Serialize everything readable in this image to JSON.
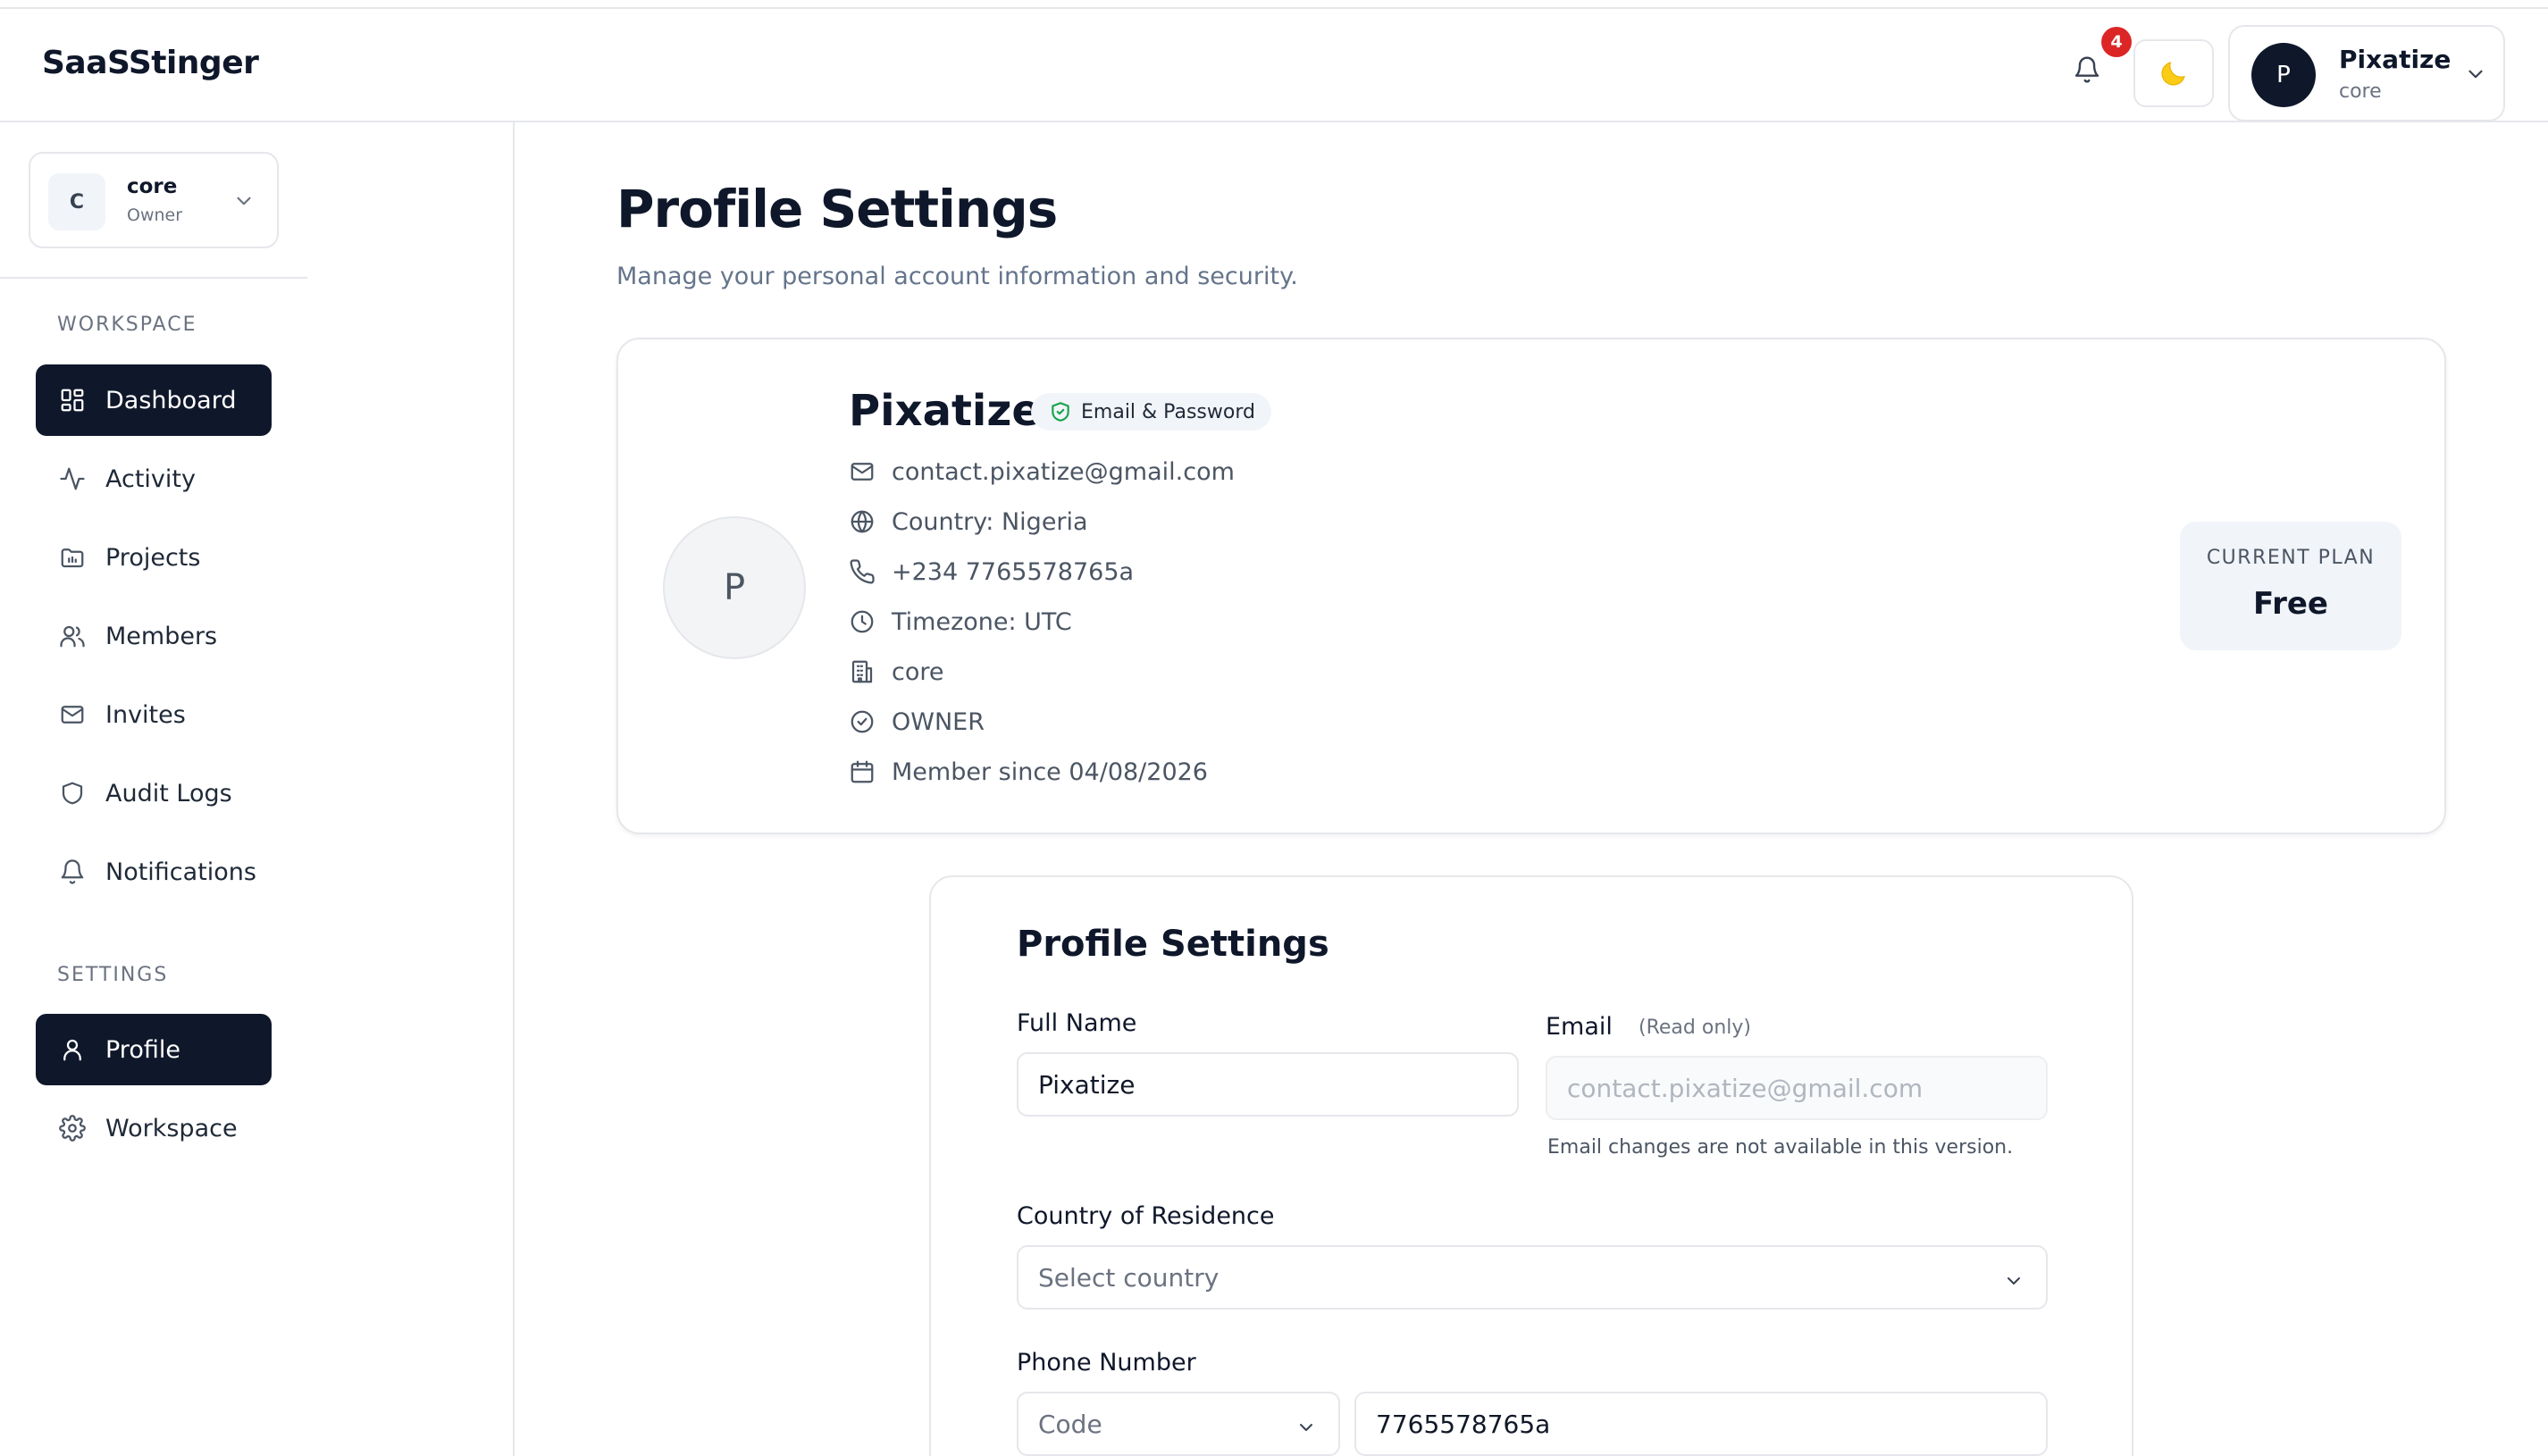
{
  "header": {
    "brand": "SaaSStinger",
    "notification_count": "4",
    "user_name": "Pixatize",
    "user_workspace": "core",
    "user_initial": "P"
  },
  "sidebar": {
    "workspace": {
      "initial": "C",
      "name": "core",
      "role": "Owner"
    },
    "workspace_section": "WORKSPACE",
    "workspace_items": [
      {
        "label": "Dashboard",
        "icon": "dashboard-icon",
        "active": true
      },
      {
        "label": "Activity",
        "icon": "activity-icon"
      },
      {
        "label": "Projects",
        "icon": "folder-icon"
      },
      {
        "label": "Members",
        "icon": "users-icon"
      },
      {
        "label": "Invites",
        "icon": "mail-icon"
      },
      {
        "label": "Audit Logs",
        "icon": "shield-icon"
      },
      {
        "label": "Notifications",
        "icon": "bell-icon"
      }
    ],
    "settings_section": "SETTINGS",
    "settings_items": [
      {
        "label": "Profile",
        "icon": "user-icon",
        "active": true
      },
      {
        "label": "Workspace",
        "icon": "gear-icon"
      }
    ]
  },
  "main": {
    "title": "Profile Settings",
    "subtitle": "Manage your personal account information and security.",
    "profile": {
      "initial": "P",
      "name": "Pixatize",
      "auth_method": "Email & Password",
      "email": "contact.pixatize@gmail.com",
      "country": "Country: Nigeria",
      "phone": "+234 7765578765a",
      "timezone": "Timezone: UTC",
      "workspace": "core",
      "role": "OWNER",
      "member_since": "Member since 04/08/2026"
    },
    "plan": {
      "label": "CURRENT PLAN",
      "value": "Free"
    },
    "form": {
      "title": "Profile Settings",
      "full_name_label": "Full Name",
      "full_name_value": "Pixatize",
      "email_label": "Email",
      "email_readonly_note": "(Read only)",
      "email_value": "contact.pixatize@gmail.com",
      "email_help": "Email changes are not available in this version.",
      "country_label": "Country of Residence",
      "country_placeholder": "Select country",
      "phone_label": "Phone Number",
      "phone_code_placeholder": "Code",
      "phone_value": "7765578765a"
    }
  },
  "colors": {
    "primary": "#0f172a",
    "badge": "#dc2626",
    "border": "#e5e7eb",
    "muted": "#64748b",
    "auth_badge_icon": "#16a34a"
  }
}
